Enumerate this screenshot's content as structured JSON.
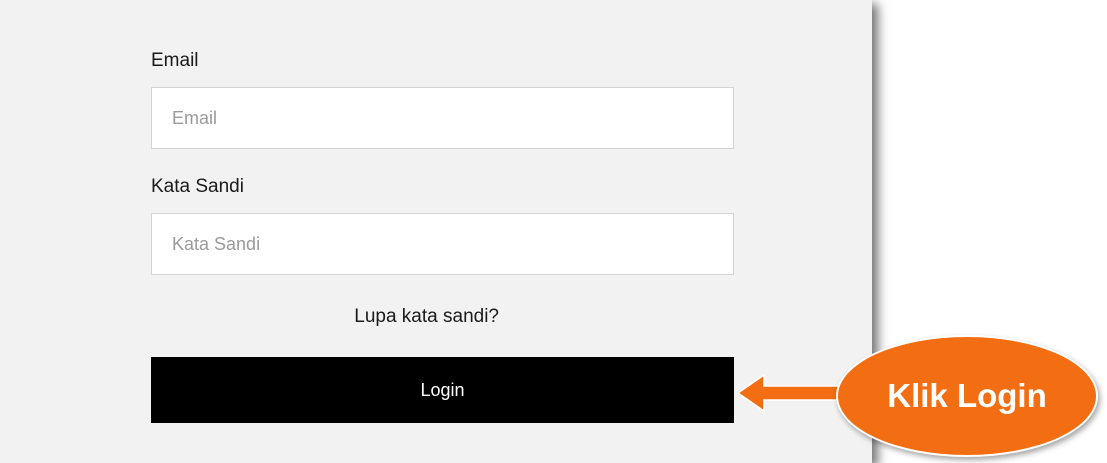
{
  "form": {
    "email_label": "Email",
    "email_placeholder": "Email",
    "email_value": "",
    "password_label": "Kata Sandi",
    "password_placeholder": "Kata Sandi",
    "password_value": "",
    "forgot_link": "Lupa kata sandi?",
    "login_button": "Login"
  },
  "annotation": {
    "callout_text": "Klik Login",
    "callout_color": "#f36d12",
    "arrow_icon": "left-arrow-icon"
  },
  "colors": {
    "panel_background": "#f2f2f2",
    "button_background": "#000000",
    "button_text": "#ffffff"
  }
}
